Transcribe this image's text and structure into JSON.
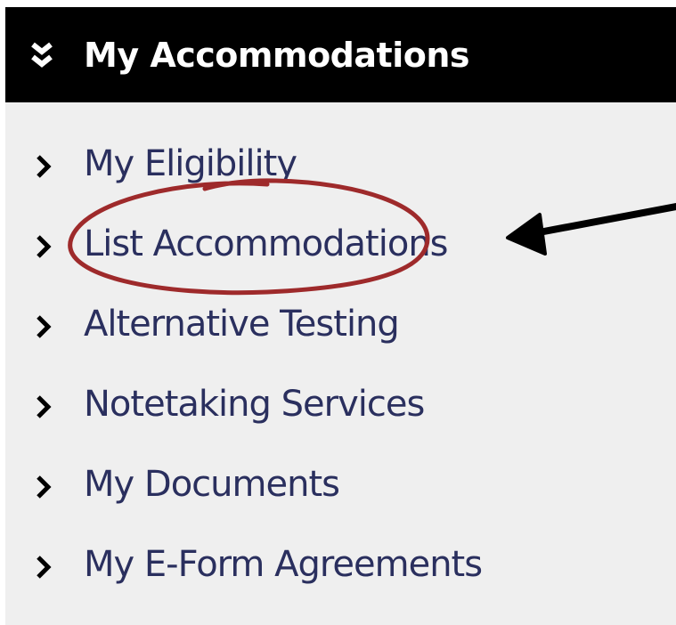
{
  "panel": {
    "title": "My Accommodations",
    "header_icon": "double-chevron-down-icon",
    "items": [
      {
        "label": "My Eligibility",
        "icon": "chevron-right-icon"
      },
      {
        "label": "List Accommodations",
        "icon": "chevron-right-icon"
      },
      {
        "label": "Alternative Testing",
        "icon": "chevron-right-icon"
      },
      {
        "label": "Notetaking Services",
        "icon": "chevron-right-icon"
      },
      {
        "label": "My Documents",
        "icon": "chevron-right-icon"
      },
      {
        "label": "My E-Form Agreements",
        "icon": "chevron-right-icon"
      }
    ]
  },
  "annotations": {
    "circle_color": "#9e2a2b",
    "arrow_color": "#000000"
  }
}
